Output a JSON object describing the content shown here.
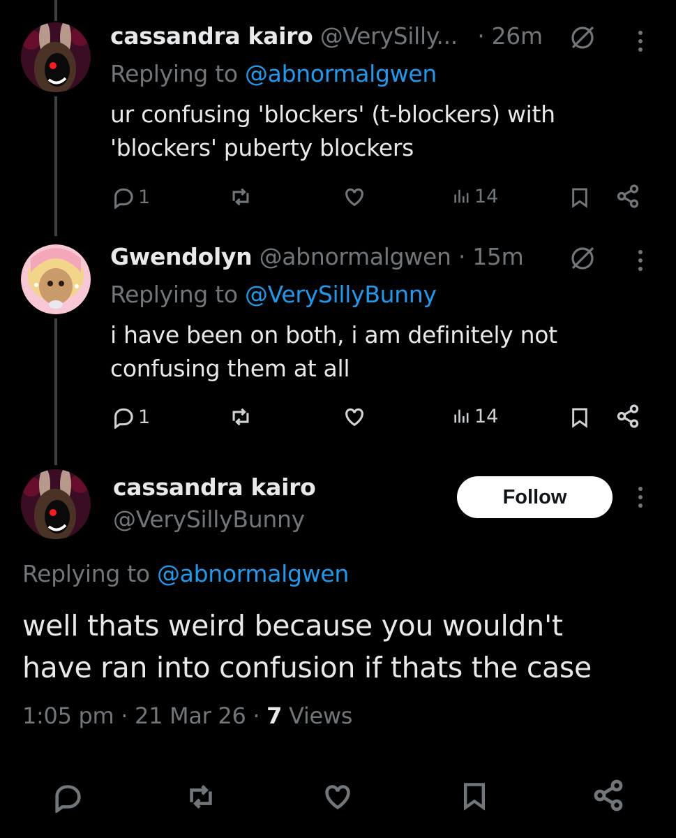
{
  "tweets": [
    {
      "display_name": "cassandra kairo",
      "handle": "@VerySilly...",
      "time": "· 26m",
      "replying_prefix": "Replying to",
      "replying_handle": "@abnormalgwen",
      "text": "ur confusing 'blockers' (t-blockers) with 'blockers' puberty blockers",
      "reply_count": "1",
      "views": "14"
    },
    {
      "display_name": "Gwendolyn",
      "handle": "@abnormalgwen",
      "time": "· 15m",
      "replying_prefix": "Replying to",
      "replying_handle": "@VerySillyBunny",
      "text": "i have been on both, i am definitely not confusing them at all",
      "reply_count": "1",
      "views": "14"
    }
  ],
  "main": {
    "display_name": "cassandra kairo",
    "handle": "@VerySillyBunny",
    "follow_label": "Follow",
    "replying_prefix": "Replying to",
    "replying_handle": "@abnormalgwen",
    "text": "well thats weird because you wouldn't have ran into confusion if thats the case",
    "time": "1:05 pm",
    "sep1": "·",
    "date": "21 Mar 26",
    "sep2": "·",
    "view_count": "7",
    "views_label": "Views"
  },
  "icons": [
    "reply-icon",
    "repost-icon",
    "like-icon",
    "views-icon",
    "bookmark-icon",
    "share-icon",
    "grok-icon",
    "more-icon"
  ],
  "colors": {
    "background": "#000000",
    "link": "#1d9bf0",
    "muted": "#71767b",
    "text": "#e7e9ea"
  }
}
